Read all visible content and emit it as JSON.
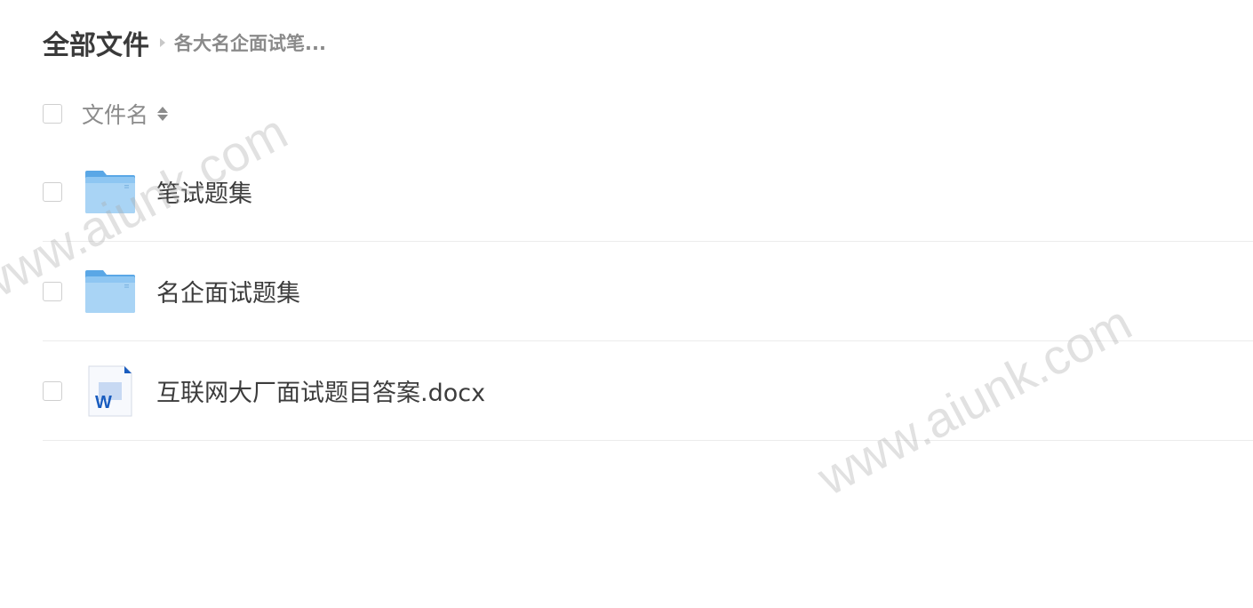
{
  "breadcrumb": {
    "root": "全部文件",
    "current": "各大名企面试笔..."
  },
  "list_header": {
    "column_name": "文件名"
  },
  "files": [
    {
      "name": "笔试题集",
      "type": "folder",
      "icon": "folder-icon"
    },
    {
      "name": "名企面试题集",
      "type": "folder",
      "icon": "folder-icon"
    },
    {
      "name": "互联网大厂面试题目答案.docx",
      "type": "docx",
      "icon": "word-doc-icon"
    }
  ],
  "watermark": {
    "text": "www.aiunk.com"
  },
  "colors": {
    "folder_light": "#a9d4f5",
    "folder_dark": "#6fb3ea",
    "word_blue": "#1a5dbf"
  }
}
